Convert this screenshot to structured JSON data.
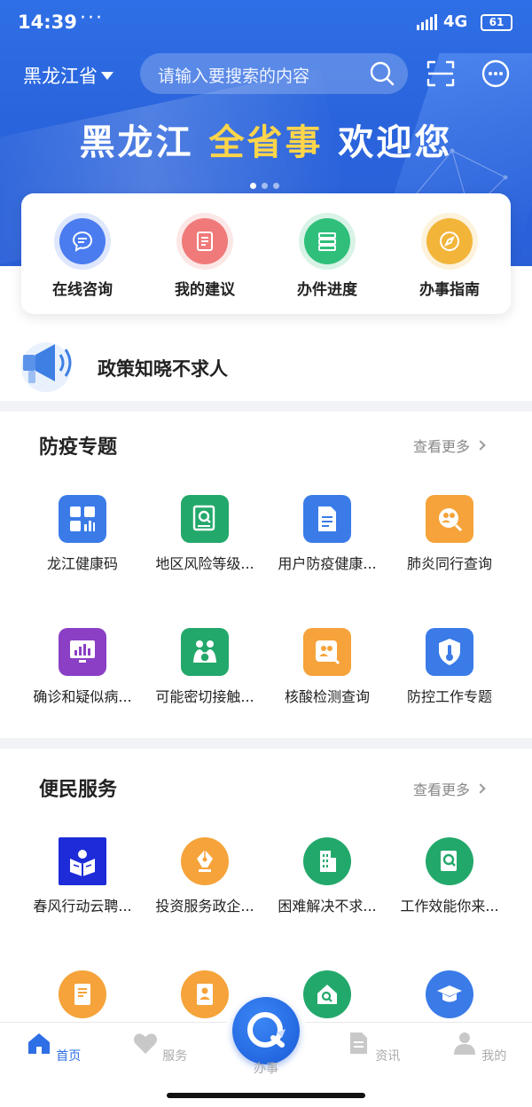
{
  "status": {
    "time": "14:39",
    "dots": "···",
    "network": "4G",
    "battery": "61"
  },
  "header": {
    "province": "黑龙江省",
    "search_placeholder": "请输入要搜索的内容",
    "welcome_part1": "黑龙江 ",
    "welcome_accent": "全省事",
    "welcome_part2": " 欢迎您"
  },
  "quick": [
    {
      "label": "在线咨询",
      "icon": "chat-icon",
      "color": "#4a7cf0"
    },
    {
      "label": "我的建议",
      "icon": "document-icon",
      "color": "#f07a7a"
    },
    {
      "label": "办件进度",
      "icon": "list-icon",
      "color": "#2fbf7a"
    },
    {
      "label": "办事指南",
      "icon": "compass-icon",
      "color": "#f2b53a"
    }
  ],
  "policy": {
    "text": "政策知晓不求人"
  },
  "sections": {
    "epidemic": {
      "title": "防疫专题",
      "more": "查看更多",
      "items": [
        {
          "label": "龙江健康码",
          "icon": "grid-icon"
        },
        {
          "label": "地区风险等级...",
          "icon": "search-doc-icon"
        },
        {
          "label": "用户防疫健康...",
          "icon": "file-icon"
        },
        {
          "label": "肺炎同行查询",
          "icon": "people-search-icon"
        },
        {
          "label": "确诊和疑似病...",
          "icon": "bar-chart-icon"
        },
        {
          "label": "可能密切接触...",
          "icon": "lungs-icon"
        },
        {
          "label": "核酸检测查询",
          "icon": "people-search-icon"
        },
        {
          "label": "防控工作专题",
          "icon": "shield-thermometer-icon"
        }
      ]
    },
    "service": {
      "title": "便民服务",
      "more": "查看更多",
      "items": [
        {
          "label": "春风行动云聘...",
          "icon": "reader-icon"
        },
        {
          "label": "投资服务政企...",
          "icon": "pen-nib-icon"
        },
        {
          "label": "困难解决不求...",
          "icon": "building-icon"
        },
        {
          "label": "工作效能你来...",
          "icon": "search-doc-icon"
        },
        {
          "label": "",
          "icon": "form-icon"
        },
        {
          "label": "",
          "icon": "id-card-icon"
        },
        {
          "label": "",
          "icon": "house-search-icon"
        },
        {
          "label": "",
          "icon": "graduation-cap-icon"
        }
      ]
    }
  },
  "nav": [
    {
      "label": "首页",
      "icon": "home-icon",
      "active": true
    },
    {
      "label": "服务",
      "icon": "heart-icon",
      "active": false
    },
    {
      "label": "办事",
      "icon": "fab-icon",
      "active": false
    },
    {
      "label": "资讯",
      "icon": "news-icon",
      "active": false
    },
    {
      "label": "我的",
      "icon": "user-icon",
      "active": false
    }
  ],
  "colors": {
    "primary": "#2f6fe6",
    "accent": "#ffd54a"
  }
}
